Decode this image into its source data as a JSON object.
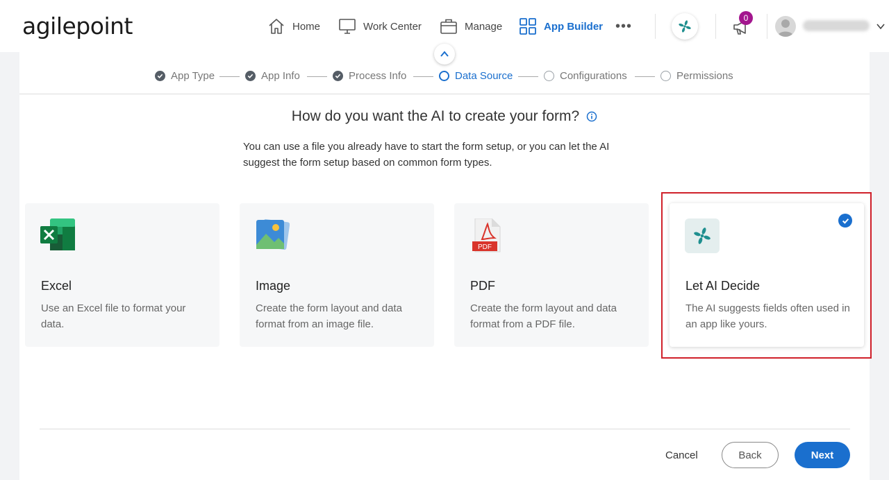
{
  "app": {
    "logo_text": "agilepoint"
  },
  "nav": {
    "items": [
      {
        "label": "Home",
        "icon": "home-icon"
      },
      {
        "label": "Work Center",
        "icon": "monitor-icon"
      },
      {
        "label": "Manage",
        "icon": "briefcase-icon"
      },
      {
        "label": "App Builder",
        "icon": "grid-icon",
        "active": true
      }
    ],
    "more_label": "•••",
    "notification_count": "0"
  },
  "stepper": {
    "steps": [
      {
        "label": "App Type",
        "state": "done"
      },
      {
        "label": "App Info",
        "state": "done"
      },
      {
        "label": "Process Info",
        "state": "done"
      },
      {
        "label": "Data Source",
        "state": "current"
      },
      {
        "label": "Configurations",
        "state": "todo"
      },
      {
        "label": "Permissions",
        "state": "todo"
      }
    ]
  },
  "main": {
    "heading": "How do you want the AI to create your form?",
    "subtext": "You can use a file you already have to start the form setup, or you can let the AI suggest the form setup based on common form types.",
    "cards": [
      {
        "title": "Excel",
        "description": "Use an Excel file to format your data.",
        "icon": "excel-icon"
      },
      {
        "title": "Image",
        "description": "Create the form layout and data format from an image file.",
        "icon": "image-icon"
      },
      {
        "title": "PDF",
        "description": "Create the form layout and data format from a PDF file.",
        "icon": "pdf-icon",
        "icon_text": "PDF"
      },
      {
        "title": "Let AI Decide",
        "description": "The AI suggests fields often used in an app like yours.",
        "icon": "ai-icon",
        "selected": true
      }
    ]
  },
  "footer": {
    "cancel_label": "Cancel",
    "back_label": "Back",
    "next_label": "Next"
  },
  "colors": {
    "accent": "#1a6fce",
    "badge": "#a3168e",
    "highlight": "#d0202a",
    "ai_teal": "#1f8f8f"
  }
}
